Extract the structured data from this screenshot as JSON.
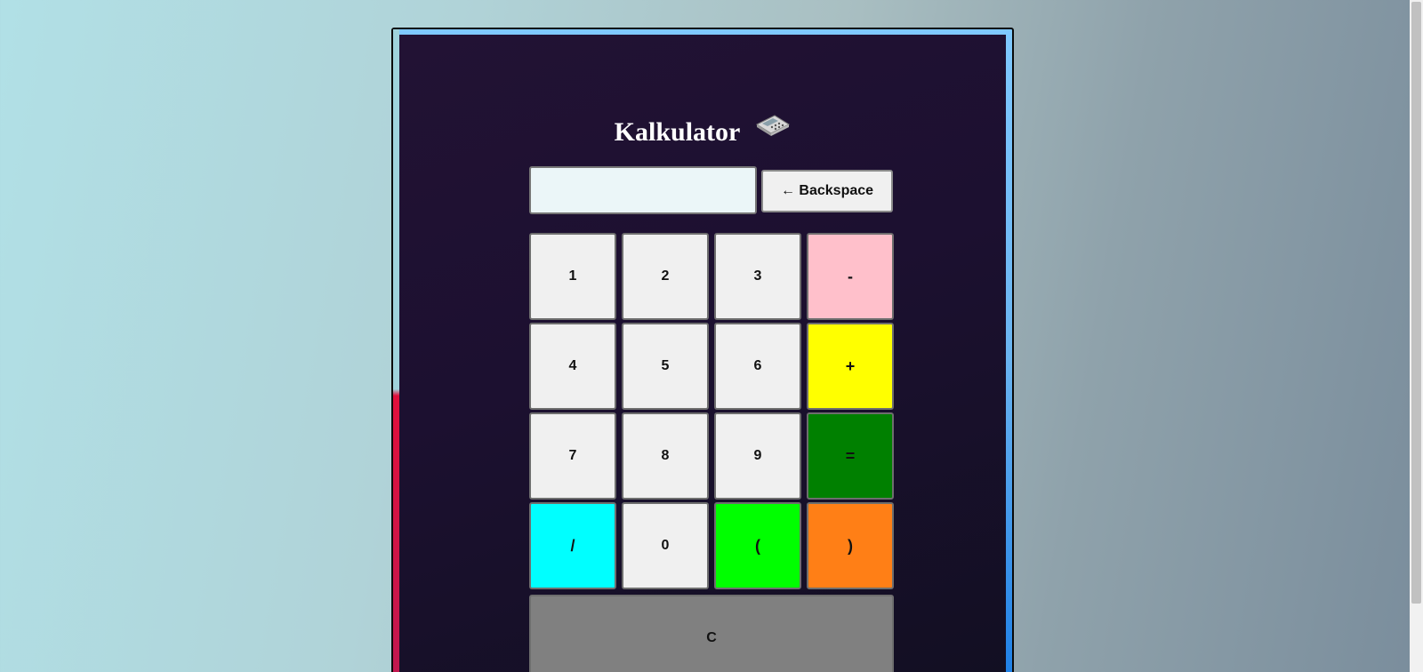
{
  "app": {
    "title": "Kalkulator",
    "title_icon": "calculator-icon"
  },
  "display": {
    "value": "",
    "placeholder": ""
  },
  "backspace": {
    "label": "← Backspace"
  },
  "keys": [
    {
      "label": "1",
      "name": "key-1",
      "color": "#f0f0f0"
    },
    {
      "label": "2",
      "name": "key-2",
      "color": "#f0f0f0"
    },
    {
      "label": "3",
      "name": "key-3",
      "color": "#f0f0f0"
    },
    {
      "label": "-",
      "name": "key-minus",
      "color": "#ffc0cb"
    },
    {
      "label": "4",
      "name": "key-4",
      "color": "#f0f0f0"
    },
    {
      "label": "5",
      "name": "key-5",
      "color": "#f0f0f0"
    },
    {
      "label": "6",
      "name": "key-6",
      "color": "#f0f0f0"
    },
    {
      "label": "+",
      "name": "key-plus",
      "color": "#ffff00"
    },
    {
      "label": "7",
      "name": "key-7",
      "color": "#f0f0f0"
    },
    {
      "label": "8",
      "name": "key-8",
      "color": "#f0f0f0"
    },
    {
      "label": "9",
      "name": "key-9",
      "color": "#f0f0f0"
    },
    {
      "label": "=",
      "name": "key-equals",
      "color": "#008000"
    },
    {
      "label": "/",
      "name": "key-divide",
      "color": "#00ffff"
    },
    {
      "label": "0",
      "name": "key-0",
      "color": "#f0f0f0"
    },
    {
      "label": "(",
      "name": "key-open-paren",
      "color": "#00ff00"
    },
    {
      "label": ")",
      "name": "key-close-paren",
      "color": "#ff7f16"
    }
  ],
  "clear": {
    "label": "C",
    "color": "#808080"
  }
}
